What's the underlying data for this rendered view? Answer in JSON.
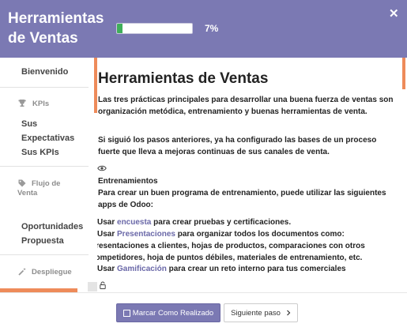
{
  "header": {
    "title": "Herramientas de Ventas",
    "progress_percent": 7,
    "progress_label": "7%",
    "close_icon": "close-icon",
    "background_color": "#7b79b3",
    "progress_color": "#3fae5a"
  },
  "sidebar": {
    "welcome": "Bienvenido",
    "kpis_header": "KPIs",
    "kpis_icon": "trophy-icon",
    "kpis_items": [
      "Sus Expectativas",
      "Sus KPIs"
    ],
    "flow_header": "Flujo de Venta",
    "flow_icon": "tag-icon",
    "flow_items": [
      "Oportunidades",
      "Propuesta"
    ],
    "deploy_header": "Despliegue",
    "deploy_icon": "wand-icon",
    "accent_color": "#ee8b5a"
  },
  "content": {
    "title": "Herramientas de Ventas",
    "intro": "Las tres prácticas principales para desarrollar una buena fuerza de ventas son organización metódica, entrenamiento y buenas herramientas de venta.",
    "note": "Si siguió los pasos anteriores, ya ha configurado las bases de un proceso fuerte que lleva a mejoras continuas de sus canales de venta.",
    "section_icon": "eye-icon",
    "section_title": "Entrenamientos",
    "section_intro": "Para crear un buen programa de entrenamiento, puede utilizar las siguientes apps de Odoo:",
    "bullets": [
      {
        "prefix": "Usar ",
        "link": "encuesta",
        "suffix": " para crear pruebas y certificaciones."
      },
      {
        "prefix": "Usar ",
        "link": "Presentaciones",
        "suffix": " para organizar todos los documentos como: presentaciones a clientes, hojas de productos, comparaciones con otros competidores, hoja de puntos débiles, materiales de entrenamiento, etc."
      },
      {
        "prefix": "Usar ",
        "link": "Gamificación",
        "suffix": " para crear un reto interno para tus comerciales"
      }
    ],
    "footer_icon": "lock-icon",
    "link_color": "#6a68a8"
  },
  "footer": {
    "done_label": "Marcar Como Realizado",
    "done_icon": "square-icon",
    "next_label": "Siguiente paso",
    "next_icon": "chevron-right-icon"
  }
}
